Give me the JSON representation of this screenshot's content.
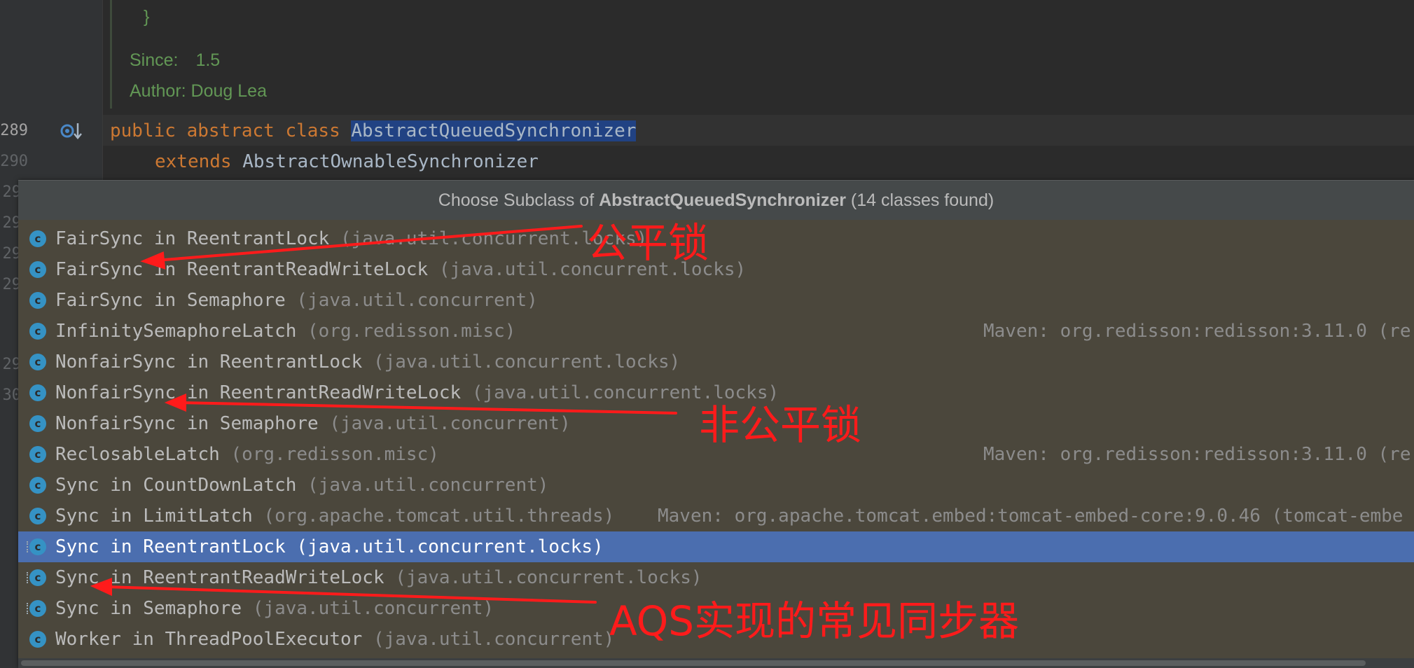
{
  "editor": {
    "line_numbers": [
      "289",
      "290",
      "29",
      "29",
      "29",
      "29",
      "29",
      "30"
    ],
    "doc_brace": "}",
    "doc_since_label": "Since:",
    "doc_since_value": "1.5",
    "doc_author": "Author: Doug Lea",
    "code_line1": {
      "kw_public": "public",
      "kw_abstract": "abstract",
      "kw_class": "class",
      "class_name": "AbstractQueuedSynchronizer"
    },
    "code_line2": {
      "kw_extends": "extends",
      "super_name": "AbstractOwnableSynchronizer"
    },
    "gutter_icon": "implemented-overridden-icon"
  },
  "popup": {
    "title_prefix": "Choose Subclass of",
    "title_class": "AbstractQueuedSynchronizer",
    "title_suffix": "(14 classes found)",
    "items": [
      {
        "name": "FairSync in ReentrantLock",
        "pkg": "(java.util.concurrent.locks)",
        "maven": "",
        "icon": "class-icon"
      },
      {
        "name": "FairSync in ReentrantReadWriteLock",
        "pkg": "(java.util.concurrent.locks)",
        "maven": "",
        "icon": "class-icon"
      },
      {
        "name": "FairSync in Semaphore",
        "pkg": "(java.util.concurrent)",
        "maven": "",
        "icon": "class-icon"
      },
      {
        "name": "InfinitySemaphoreLatch",
        "pkg": "(org.redisson.misc)",
        "maven": "Maven: org.redisson:redisson:3.11.0 (re",
        "icon": "class-icon"
      },
      {
        "name": "NonfairSync in ReentrantLock",
        "pkg": "(java.util.concurrent.locks)",
        "maven": "",
        "icon": "class-icon"
      },
      {
        "name": "NonfairSync in ReentrantReadWriteLock",
        "pkg": "(java.util.concurrent.locks)",
        "maven": "",
        "icon": "class-icon"
      },
      {
        "name": "NonfairSync in Semaphore",
        "pkg": "(java.util.concurrent)",
        "maven": "",
        "icon": "class-icon"
      },
      {
        "name": "ReclosableLatch",
        "pkg": "(org.redisson.misc)",
        "maven": "Maven: org.redisson:redisson:3.11.0 (re",
        "icon": "class-icon"
      },
      {
        "name": "Sync in CountDownLatch",
        "pkg": "(java.util.concurrent)",
        "maven": "",
        "icon": "class-icon"
      },
      {
        "name": "Sync in LimitLatch",
        "pkg": "(org.apache.tomcat.util.threads)",
        "maven": "Maven: org.apache.tomcat.embed:tomcat-embed-core:9.0.46 (tomcat-embe",
        "icon": "class-icon"
      },
      {
        "name": "Sync in ReentrantLock",
        "pkg": "(java.util.concurrent.locks)",
        "maven": "",
        "icon": "abstract-class-icon"
      },
      {
        "name": "Sync in ReentrantReadWriteLock",
        "pkg": "(java.util.concurrent.locks)",
        "maven": "",
        "icon": "abstract-class-icon"
      },
      {
        "name": "Sync in Semaphore",
        "pkg": "(java.util.concurrent)",
        "maven": "",
        "icon": "abstract-class-icon"
      },
      {
        "name": "Worker in ThreadPoolExecutor",
        "pkg": "(java.util.concurrent)",
        "maven": "",
        "icon": "class-icon"
      }
    ],
    "selected_index": 10
  },
  "annotations": {
    "fair_lock": "公平锁",
    "nonfair_lock": "非公平锁",
    "aqs_common": "AQS实现的常见同步器",
    "color": "#ff1b1b"
  }
}
